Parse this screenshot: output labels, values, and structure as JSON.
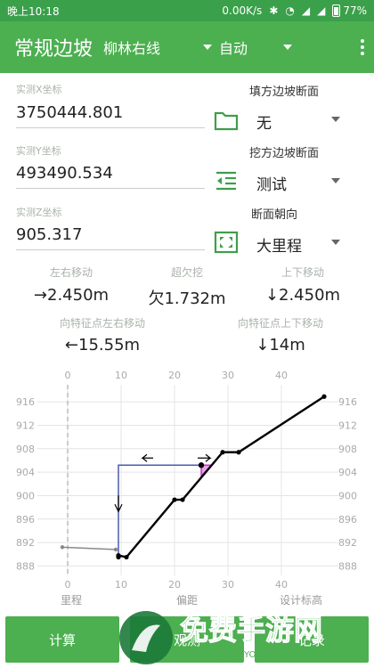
{
  "status": {
    "time": "晚上10:18",
    "speed": "0.00K/s",
    "battery": "77%"
  },
  "appbar": {
    "title": "常规边坡",
    "line": "柳林右线",
    "mode": "自动"
  },
  "fields": {
    "x_label": "实测X坐标",
    "x_value": "3750444.801",
    "y_label": "实测Y坐标",
    "y_value": "493490.534",
    "z_label": "实测Z坐标",
    "z_value": "905.317"
  },
  "right": {
    "fill_label": "填方边坡断面",
    "fill_value": "无",
    "cut_label": "挖方边坡断面",
    "cut_value": "测试",
    "dir_label": "断面朝向",
    "dir_value": "大里程"
  },
  "stats": {
    "lr_label": "左右移动",
    "lr_value": "→2.450m",
    "cut_label": "超欠挖",
    "cut_value": "欠1.732m",
    "ud_label": "上下移动",
    "ud_value": "↓2.450m",
    "feat_lr_label": "向特征点左右移动",
    "feat_lr_value": "←15.55m",
    "feat_ud_label": "向特征点上下移动",
    "feat_ud_value": "↓14m"
  },
  "chart_data": {
    "type": "line",
    "x_ticks": [
      "0",
      "10",
      "20",
      "30",
      "40"
    ],
    "y_ticks": [
      "888",
      "892",
      "896",
      "900",
      "904",
      "908",
      "912",
      "916"
    ],
    "xlim": [
      -5,
      50
    ],
    "ylim": [
      887,
      918
    ],
    "legend": [
      "里程",
      "偏距",
      "设计标高"
    ],
    "series": [
      {
        "x": [
          -1,
          9
        ],
        "y": [
          891.2,
          890.8
        ],
        "color": "#888888"
      },
      {
        "x": [
          9.5,
          9.5,
          11,
          20,
          21.5,
          29,
          32,
          48
        ],
        "y": [
          889.5,
          889.8,
          889.5,
          899.3,
          899.3,
          907.4,
          907.4,
          916.9
        ],
        "color": "#000000"
      }
    ],
    "guide": {
      "x_from": 9.5,
      "x_to": 25,
      "y_from": 889.8,
      "y_to": 905.2
    }
  },
  "buttons": {
    "calc": "计算",
    "observe": "观测",
    "record": "记录"
  },
  "watermark": {
    "main": "免费手游网",
    "sub": "MIANFEISHOUYOUWANG"
  },
  "colors": {
    "primary": "#4caf50",
    "status": "#3aa04a",
    "magenta": "#cc33cc"
  }
}
